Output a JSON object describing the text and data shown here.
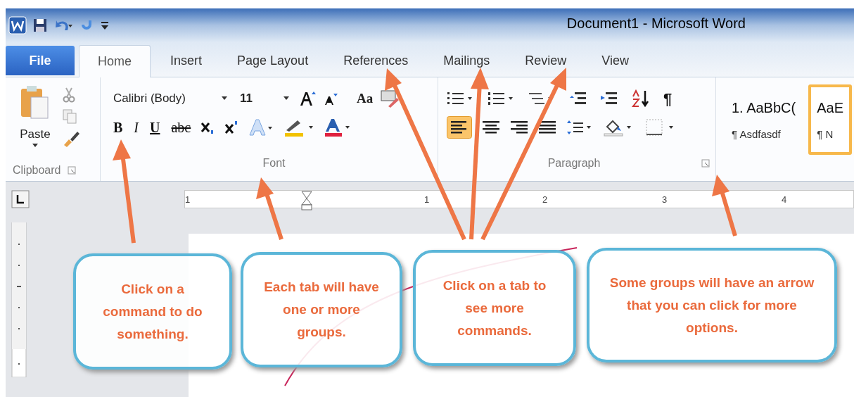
{
  "window": {
    "title": "Document1  -  Microsoft Word"
  },
  "tabs": [
    {
      "label": "File",
      "kind": "file",
      "selected": false
    },
    {
      "label": "Home",
      "kind": "tab",
      "selected": true
    },
    {
      "label": "Insert",
      "kind": "tab",
      "selected": false
    },
    {
      "label": "Page Layout",
      "kind": "tab",
      "selected": false
    },
    {
      "label": "References",
      "kind": "tab",
      "selected": false
    },
    {
      "label": "Mailings",
      "kind": "tab",
      "selected": false
    },
    {
      "label": "Review",
      "kind": "tab",
      "selected": false
    },
    {
      "label": "View",
      "kind": "tab",
      "selected": false
    }
  ],
  "clipboard": {
    "label": "Clipboard",
    "paste": "Paste"
  },
  "font": {
    "label": "Font",
    "font_name": "Calibri (Body)",
    "font_size": "11",
    "case_button": "Aa",
    "format_buttons": [
      "B",
      "I",
      "U",
      "abc"
    ]
  },
  "paragraph": {
    "label": "Paragraph",
    "show_marks": "¶"
  },
  "styles": [
    {
      "preview": "1.  AaBbC(",
      "name": "¶ Asdfasdf",
      "selected": false
    },
    {
      "preview": "AaE",
      "name": "¶ N",
      "selected": true
    }
  ],
  "ruler": {
    "numbers": [
      "1",
      "1",
      "2",
      "3",
      "4"
    ]
  },
  "callouts": [
    "Click on a command to do something.",
    "Each tab will have one or more groups.",
    "Click on a tab to see more commands.",
    "Some groups will have an arrow that you can click for more options."
  ]
}
